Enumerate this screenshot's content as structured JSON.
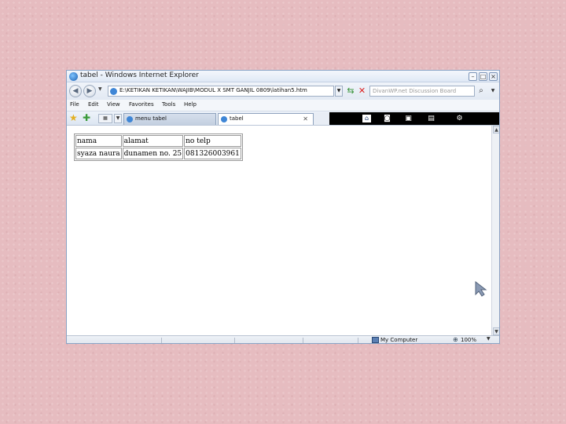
{
  "window": {
    "title": "tabel - Windows Internet Explorer"
  },
  "address_bar": {
    "url": "E:\\KETIKAN KETIKAN\\WAJIB\\MODUL X SMT GANJIL 0809\\latihan5.htm",
    "search_placeholder": "DivanWP.net Discussion Board"
  },
  "menu": {
    "items": [
      "File",
      "Edit",
      "View",
      "Favorites",
      "Tools",
      "Help"
    ]
  },
  "tabs": [
    {
      "label": "menu tabel"
    },
    {
      "label": "tabel"
    }
  ],
  "content": {
    "table": {
      "headers": [
        "nama",
        "alamat",
        "no telp"
      ],
      "rows": [
        [
          "syaza naura",
          "dunamen no. 25",
          "081326003961"
        ]
      ]
    }
  },
  "status_bar": {
    "zone": "My Computer",
    "zoom": "100%"
  },
  "icons": {
    "browser": "ie-icon",
    "back": "back-arrow-icon",
    "forward": "forward-arrow-icon",
    "refresh": "refresh-icon",
    "stop": "stop-icon",
    "search": "search-icon",
    "favorites": "star-icon",
    "add_favorite": "add-favorite-icon",
    "home": "home-icon",
    "feeds": "feeds-icon",
    "print": "print-icon",
    "page": "page-icon",
    "tools": "tools-icon"
  },
  "colors": {
    "background": "#e6bcc0",
    "chrome": "#dfe8f5",
    "command_bar": "#000000"
  }
}
